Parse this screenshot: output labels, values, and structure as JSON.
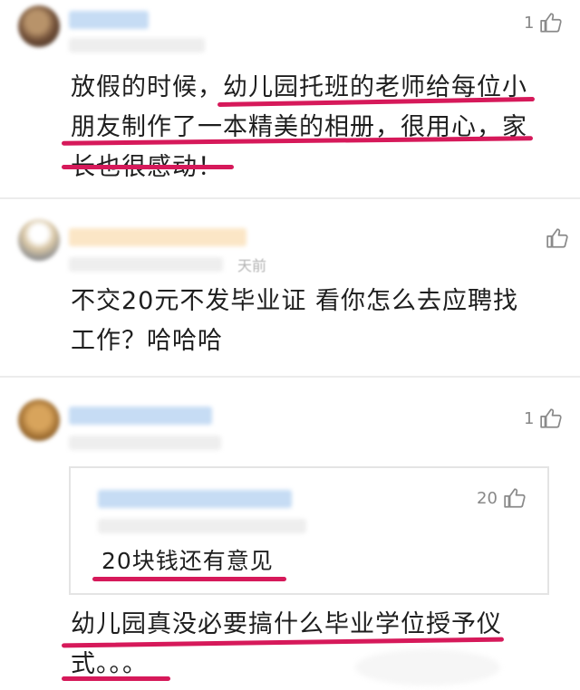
{
  "comments": [
    {
      "like_count": "1",
      "text_lines": [
        "放假的时候，幼儿园托班的老师给每位小",
        "朋友制作了一本精美的相册，很用心，家",
        "长也很感动！"
      ]
    },
    {
      "like_count": "",
      "meta_time": "天前",
      "text_lines": [
        "不交20元不发毕业证 看你怎么去应聘找",
        "工作？哈哈哈"
      ]
    },
    {
      "like_count": "1",
      "quoted": {
        "like_count": "20",
        "text": "20块钱还有意见"
      },
      "text_lines": [
        "幼儿园真没必要搞什么毕业学位授予仪",
        "式。。。"
      ]
    }
  ],
  "icons": {
    "like": "thumbs-up-icon"
  },
  "colors": {
    "underline": "#d6195a",
    "avatar_blur": "#cfe1f5",
    "divider": "#ececec"
  }
}
